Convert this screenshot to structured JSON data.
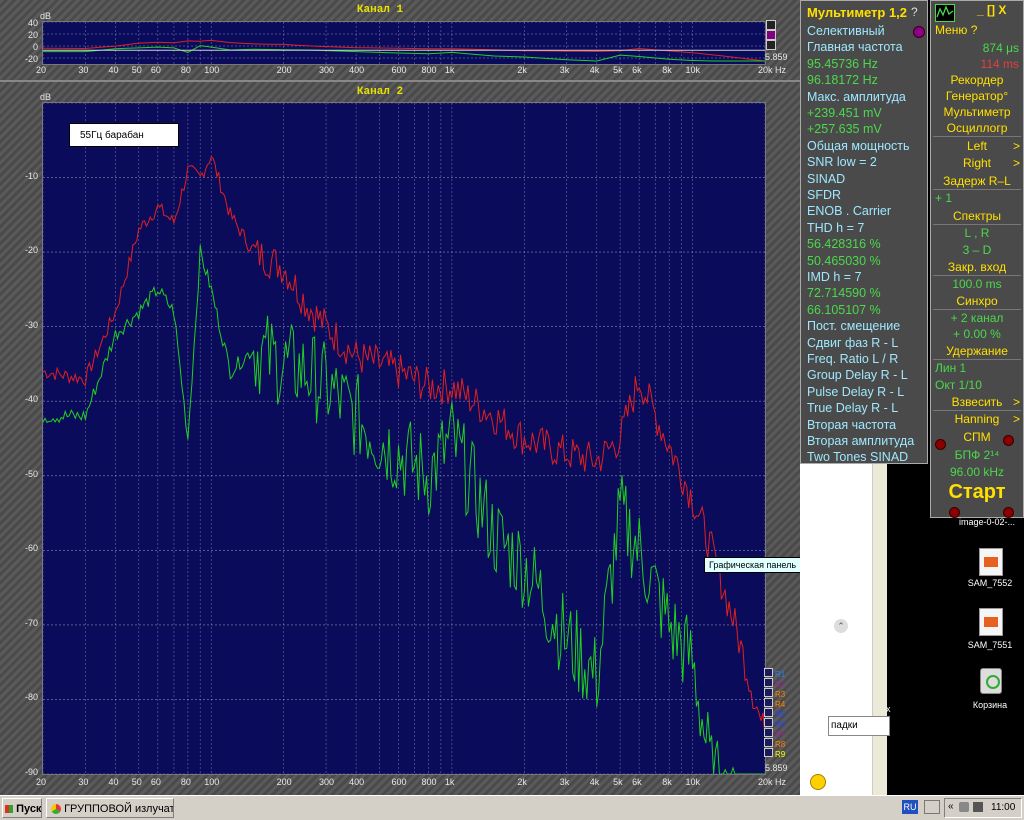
{
  "channel1": {
    "title": "Канал 1",
    "db_label": "dB",
    "y_ticks": [
      "40",
      "20",
      "0",
      "-20"
    ],
    "x_ticks": [
      "20",
      "30",
      "40",
      "50",
      "60",
      "80",
      "100",
      "200",
      "300",
      "400",
      "600",
      "800",
      "1k",
      "2k",
      "3k",
      "4k",
      "5k",
      "6k",
      "8k",
      "10k",
      "20k Hz"
    ],
    "scale_value": "5.859"
  },
  "channel2": {
    "title": "Канал 2",
    "db_label": "dB",
    "y_ticks": [
      "-10",
      "-20",
      "-30",
      "-40",
      "-50",
      "-60",
      "-70",
      "-80",
      "-90"
    ],
    "x_ticks": [
      "20",
      "30",
      "40",
      "50",
      "60",
      "80",
      "100",
      "200",
      "300",
      "400",
      "600",
      "800",
      "1k",
      "2k",
      "3k",
      "4k",
      "5k",
      "6k",
      "8k",
      "10k",
      "20k Hz"
    ],
    "note": "55Гц  барабан",
    "scale_value": "5.859",
    "tooltip": "Графическая панель",
    "registers": [
      "R1",
      "R2",
      "R3",
      "R4",
      "R5",
      "R6",
      "R7",
      "R8",
      "R9"
    ]
  },
  "chart_data": {
    "type": "line",
    "title": "Канал 2",
    "ylabel": "dB",
    "xlabel": "Hz",
    "x_scale": "log",
    "xlim": [
      20,
      20000
    ],
    "ylim": [
      -90,
      0
    ],
    "grid": true,
    "x": [
      20,
      30,
      40,
      50,
      60,
      70,
      80,
      90,
      100,
      120,
      150,
      200,
      250,
      300,
      400,
      500,
      600,
      800,
      1000,
      1500,
      2000,
      3000,
      4000,
      5000,
      6000,
      8000,
      10000,
      12000,
      15000,
      20000
    ],
    "series": [
      {
        "color": "#e02020",
        "values": [
          -36,
          -37,
          -28,
          -17,
          -14,
          -16,
          -9,
          -10,
          -7,
          -15,
          -20,
          -22,
          -27,
          -30,
          -34,
          -35,
          -36,
          -38,
          -38,
          -42,
          -45,
          -47,
          -48,
          -45,
          -37,
          -46,
          -53,
          -60,
          -70,
          -85
        ]
      },
      {
        "color": "#20d020",
        "values": [
          -42,
          -42,
          -31,
          -28,
          -25,
          -28,
          -45,
          -20,
          -25,
          -36,
          -33,
          -35,
          -36,
          -38,
          -42,
          -45,
          -47,
          -50,
          -45,
          -58,
          -62,
          -72,
          -77,
          -55,
          -60,
          -70,
          -75,
          -90,
          -95,
          -100
        ]
      }
    ]
  },
  "multimeter": {
    "title": "Мультиметр 1,2",
    "help": "?",
    "rows": [
      "Селективный",
      "Главная частота",
      "95.45736  Hz",
      "96.18172  Hz",
      "Макс. амплитуда",
      "+239.451 mV",
      "+257.635 mV",
      "Общая мощность",
      "SNR      low =    2",
      "SINAD",
      "SFDR",
      "ENOB . Carrier",
      "THD         h =   7",
      "56.428316 %",
      "50.465030 %",
      "IMD         h =   7",
      "72.714590 %",
      "66.105107 %",
      "Пост. смещение",
      "Сдвиг фаз R - L",
      "Freq. Ratio  L / R",
      "Group Delay R - L",
      "Pulse Delay R - L",
      "True Delay R - L",
      "Вторая частота",
      "Вторая амплитуда",
      "Two Tones SINAD"
    ]
  },
  "menu": {
    "window_buttons": "_ []  X",
    "items": [
      "Меню         ?",
      "874  μs",
      "114  ms",
      "Рекордер",
      "Генератор°",
      "Мультиметр",
      "Осциллогр",
      "Left",
      "Right",
      "Задерж  R–L",
      "+        1",
      "Спектры",
      "L , R",
      "3 – D",
      "Закр. вход",
      "100.0 ms",
      "Синхро",
      "+ 2 канал",
      "+ 0.00 %",
      "Удержание",
      "Лин       1",
      "Окт   1/10",
      "Взвесить",
      "Hanning",
      "СПМ",
      "БПФ  2¹⁴",
      "96.00 kHz",
      "Старт"
    ]
  },
  "desktop": {
    "icons": [
      {
        "label": "image-0-02-..."
      },
      {
        "label": "SAM_7552"
      },
      {
        "label": "SAM_7551"
      },
      {
        "label": "Корзина"
      }
    ]
  },
  "browser_fragment": {
    "text": "падки",
    "x_mark": "x"
  },
  "taskbar": {
    "start": "Пуск",
    "task": "ГРУППОВОЙ излучател...",
    "lang": "RU",
    "clock": "11:00"
  }
}
